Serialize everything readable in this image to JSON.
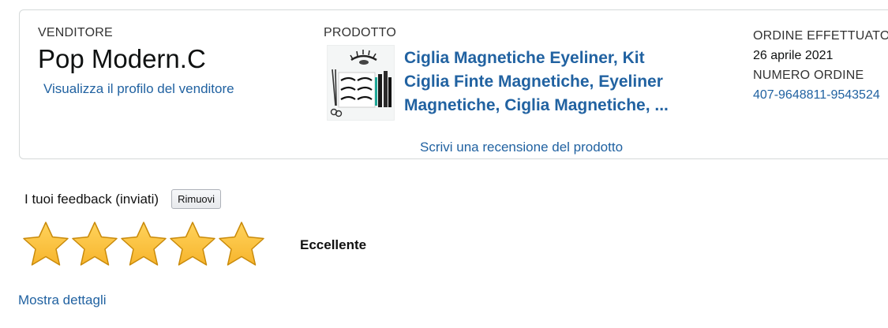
{
  "seller": {
    "label": "VENDITORE",
    "name": "Pop Modern.C",
    "profile_link": "Visualizza il profilo del venditore"
  },
  "product": {
    "label": "PRODOTTO",
    "title": "Ciglia Magnetiche Eyeliner, Kit Ciglia Finte Magnetiche, Eyeliner Magnetiche, Ciglia Magnetiche, ...",
    "review_link": "Scrivi una recensione del prodotto",
    "thumbnail_icon": "eyelash-kit-image"
  },
  "order": {
    "placed_label": "ORDINE EFFETTUATO",
    "placed_date": "26 aprile 2021",
    "number_label": "NUMERO ORDINE",
    "number_value": "407-9648811-9543524"
  },
  "feedback": {
    "label": "I tuoi feedback (inviati)",
    "remove_button": "Rimuovi",
    "rating": 5,
    "rating_max": 5,
    "rating_text": "Eccellente",
    "star_color": "#f7b52d",
    "details_link": "Mostra dettagli"
  },
  "colors": {
    "link": "#2162a1",
    "border": "#d5d9d9"
  }
}
